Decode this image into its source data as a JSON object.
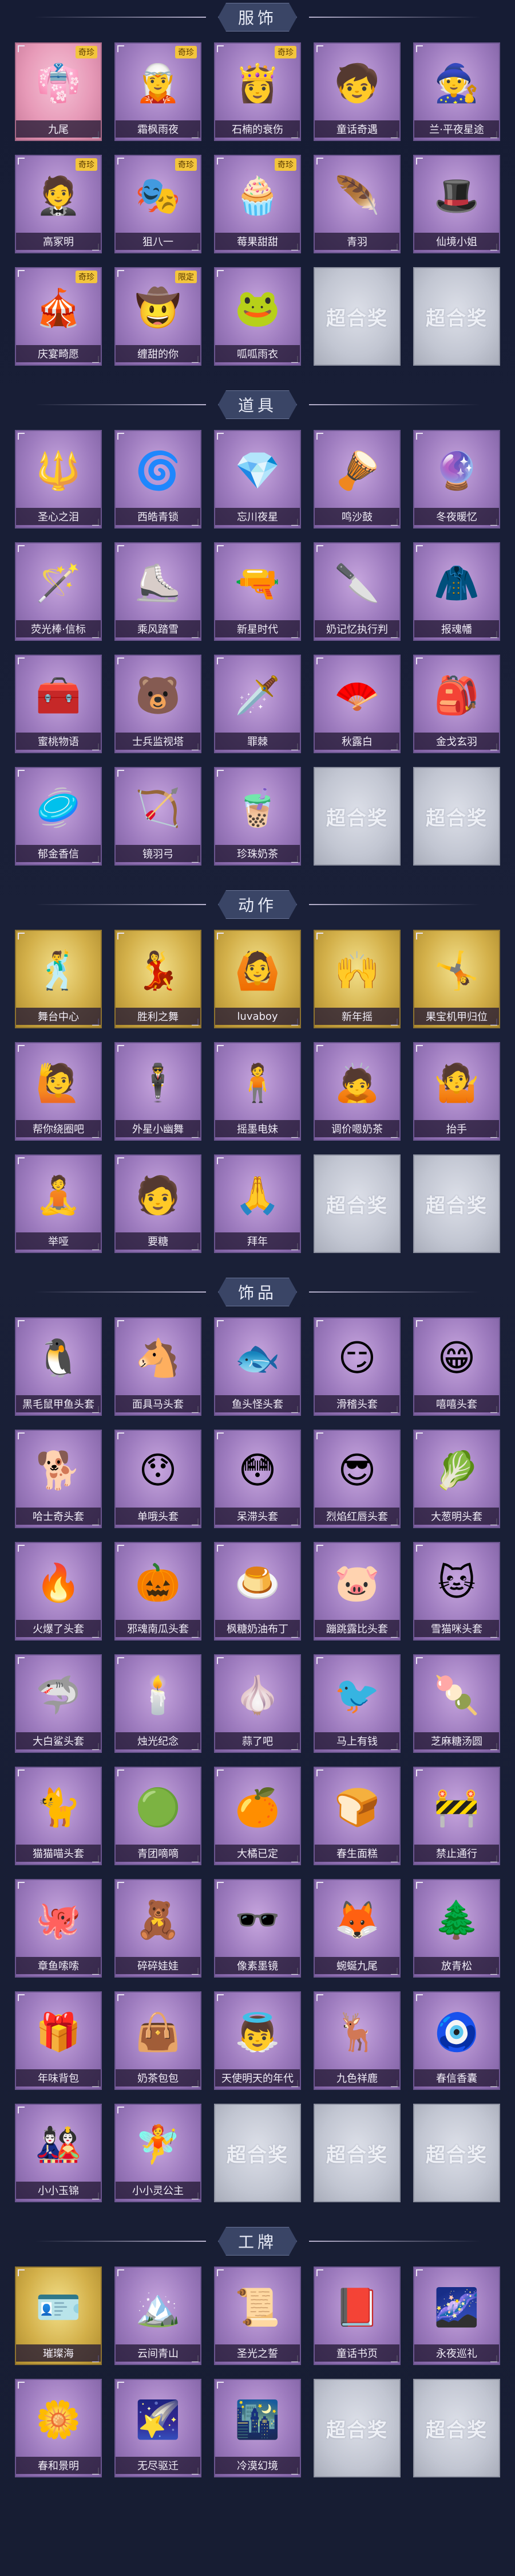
{
  "placeholder_text": "超合奖",
  "sections": [
    {
      "id": "outfits",
      "title": "服饰",
      "items": [
        {
          "name": "九尾",
          "icon": "👘",
          "style": "pink",
          "badge": "奇珍"
        },
        {
          "name": "霜枫雨夜",
          "icon": "🧝",
          "style": "purple",
          "badge": "奇珍"
        },
        {
          "name": "石楠的衰伤",
          "icon": "👸",
          "style": "purple",
          "badge": "奇珍"
        },
        {
          "name": "童话奇遇",
          "icon": "🧒",
          "style": "purple",
          "badge": ""
        },
        {
          "name": "兰·平夜星途",
          "icon": "🧙",
          "style": "purple",
          "badge": ""
        },
        {
          "name": "高冢明",
          "icon": "🤵",
          "style": "purple",
          "badge": "奇珍"
        },
        {
          "name": "狙八一",
          "icon": "🎭",
          "style": "purple",
          "badge": "奇珍"
        },
        {
          "name": "莓果甜甜",
          "icon": "🧁",
          "style": "purple",
          "badge": "奇珍"
        },
        {
          "name": "青羽",
          "icon": "🪶",
          "style": "purple",
          "badge": ""
        },
        {
          "name": "仙境小姐",
          "icon": "🎩",
          "style": "purple",
          "badge": ""
        },
        {
          "name": "庆宴畸愿",
          "icon": "🎪",
          "style": "purple",
          "badge": "奇珍"
        },
        {
          "name": "缠甜的你",
          "icon": "🤠",
          "style": "purple",
          "badge": "限定"
        },
        {
          "name": "呱呱雨衣",
          "icon": "🐸",
          "style": "purple",
          "badge": ""
        },
        {
          "name": "",
          "icon": "",
          "style": "empty",
          "badge": ""
        },
        {
          "name": "",
          "icon": "",
          "style": "empty",
          "badge": ""
        }
      ]
    },
    {
      "id": "props",
      "title": "道具",
      "items": [
        {
          "name": "圣心之泪",
          "icon": "🔱",
          "style": "purple",
          "badge": ""
        },
        {
          "name": "西皓青锁",
          "icon": "🌀",
          "style": "purple",
          "badge": ""
        },
        {
          "name": "忘川夜星",
          "icon": "💎",
          "style": "purple",
          "badge": ""
        },
        {
          "name": "鸣沙鼓",
          "icon": "🪘",
          "style": "purple",
          "badge": ""
        },
        {
          "name": "冬夜暖忆",
          "icon": "🔮",
          "style": "purple",
          "badge": ""
        },
        {
          "name": "荧光棒·信标",
          "icon": "🪄",
          "style": "purple",
          "badge": ""
        },
        {
          "name": "乘风踏雪",
          "icon": "⛸️",
          "style": "purple",
          "badge": ""
        },
        {
          "name": "新星时代",
          "icon": "🔫",
          "style": "purple",
          "badge": ""
        },
        {
          "name": "奶记忆执行判",
          "icon": "🔪",
          "style": "purple",
          "badge": ""
        },
        {
          "name": "报魂幡",
          "icon": "🧥",
          "style": "purple",
          "badge": ""
        },
        {
          "name": "蜜桃物语",
          "icon": "🧰",
          "style": "purple",
          "badge": ""
        },
        {
          "name": "士兵监视塔",
          "icon": "🐻",
          "style": "purple",
          "badge": ""
        },
        {
          "name": "罪棘",
          "icon": "🗡️",
          "style": "purple",
          "badge": ""
        },
        {
          "name": "秋露白",
          "icon": "🪭",
          "style": "purple",
          "badge": ""
        },
        {
          "name": "金戈玄羽",
          "icon": "🎒",
          "style": "purple",
          "badge": ""
        },
        {
          "name": "郁金香信",
          "icon": "🥏",
          "style": "purple",
          "badge": ""
        },
        {
          "name": "镜羽弓",
          "icon": "🏹",
          "style": "purple",
          "badge": ""
        },
        {
          "name": "珍珠奶茶",
          "icon": "🧋",
          "style": "purple",
          "badge": ""
        },
        {
          "name": "",
          "icon": "",
          "style": "empty",
          "badge": ""
        },
        {
          "name": "",
          "icon": "",
          "style": "empty",
          "badge": ""
        }
      ]
    },
    {
      "id": "actions",
      "title": "动作",
      "items": [
        {
          "name": "舞台中心",
          "icon": "🕺",
          "style": "gold",
          "badge": ""
        },
        {
          "name": "胜利之舞",
          "icon": "💃",
          "style": "gold",
          "badge": ""
        },
        {
          "name": "luvaboy",
          "icon": "🙆",
          "style": "gold",
          "badge": ""
        },
        {
          "name": "新年摇",
          "icon": "🙌",
          "style": "gold",
          "badge": ""
        },
        {
          "name": "果宝机甲归位",
          "icon": "🤸",
          "style": "gold",
          "badge": ""
        },
        {
          "name": "帮你绕圈吧",
          "icon": "🙋",
          "style": "purple",
          "badge": ""
        },
        {
          "name": "外星小幽舞",
          "icon": "🕴️",
          "style": "purple",
          "badge": ""
        },
        {
          "name": "摇墨电妹",
          "icon": "🧍",
          "style": "purple",
          "badge": ""
        },
        {
          "name": "调价嗯奶茶",
          "icon": "🙇",
          "style": "purple",
          "badge": ""
        },
        {
          "name": "抬手",
          "icon": "🤷",
          "style": "purple",
          "badge": ""
        },
        {
          "name": "举哑",
          "icon": "🧘",
          "style": "purple",
          "badge": ""
        },
        {
          "name": "要糖",
          "icon": "🧑",
          "style": "purple",
          "badge": ""
        },
        {
          "name": "拜年",
          "icon": "🙏",
          "style": "purple",
          "badge": ""
        },
        {
          "name": "",
          "icon": "",
          "style": "empty",
          "badge": ""
        },
        {
          "name": "",
          "icon": "",
          "style": "empty",
          "badge": ""
        }
      ]
    },
    {
      "id": "accessories",
      "title": "饰品",
      "items": [
        {
          "name": "黑毛鼠甲鱼头套",
          "icon": "🐧",
          "style": "purple",
          "badge": ""
        },
        {
          "name": "面具马头套",
          "icon": "🐴",
          "style": "purple",
          "badge": ""
        },
        {
          "name": "鱼头怪头套",
          "icon": "🐟",
          "style": "purple",
          "badge": ""
        },
        {
          "name": "滑稽头套",
          "icon": "😏",
          "style": "purple",
          "badge": ""
        },
        {
          "name": "嘻嘻头套",
          "icon": "😁",
          "style": "purple",
          "badge": ""
        },
        {
          "name": "哈士奇头套",
          "icon": "🐕",
          "style": "purple",
          "badge": ""
        },
        {
          "name": "单哦头套",
          "icon": "😯",
          "style": "purple",
          "badge": ""
        },
        {
          "name": "呆滞头套",
          "icon": "😳",
          "style": "purple",
          "badge": ""
        },
        {
          "name": "烈焰红唇头套",
          "icon": "😎",
          "style": "purple",
          "badge": ""
        },
        {
          "name": "大葱明头套",
          "icon": "🥬",
          "style": "purple",
          "badge": ""
        },
        {
          "name": "火爆了头套",
          "icon": "🔥",
          "style": "purple",
          "badge": ""
        },
        {
          "name": "邪魂南瓜头套",
          "icon": "🎃",
          "style": "purple",
          "badge": ""
        },
        {
          "name": "枫糖奶油布丁",
          "icon": "🍮",
          "style": "purple",
          "badge": ""
        },
        {
          "name": "蹦跳露比头套",
          "icon": "🐷",
          "style": "purple",
          "badge": ""
        },
        {
          "name": "雪猫咪头套",
          "icon": "🐱",
          "style": "purple",
          "badge": ""
        },
        {
          "name": "大白鲨头套",
          "icon": "🦈",
          "style": "purple",
          "badge": ""
        },
        {
          "name": "烛光纪念",
          "icon": "🕯️",
          "style": "purple",
          "badge": ""
        },
        {
          "name": "蒜了吧",
          "icon": "🧄",
          "style": "purple",
          "badge": ""
        },
        {
          "name": "马上有钱",
          "icon": "🐦",
          "style": "purple",
          "badge": ""
        },
        {
          "name": "芝麻糖汤圆",
          "icon": "🍡",
          "style": "purple",
          "badge": ""
        },
        {
          "name": "猫猫喵头套",
          "icon": "🐈",
          "style": "purple",
          "badge": ""
        },
        {
          "name": "青团嘀嘀",
          "icon": "🟢",
          "style": "purple",
          "badge": ""
        },
        {
          "name": "大橘已定",
          "icon": "🍊",
          "style": "purple",
          "badge": ""
        },
        {
          "name": "春生面糕",
          "icon": "🍞",
          "style": "purple",
          "badge": ""
        },
        {
          "name": "禁止通行",
          "icon": "🚧",
          "style": "purple",
          "badge": ""
        },
        {
          "name": "章鱼嗦嗦",
          "icon": "🐙",
          "style": "purple",
          "badge": ""
        },
        {
          "name": "碎碎娃娃",
          "icon": "🧸",
          "style": "purple",
          "badge": ""
        },
        {
          "name": "像素墨镜",
          "icon": "🕶️",
          "style": "purple",
          "badge": ""
        },
        {
          "name": "蜿蜒九尾",
          "icon": "🦊",
          "style": "purple",
          "badge": ""
        },
        {
          "name": "放青松",
          "icon": "🌲",
          "style": "purple",
          "badge": ""
        },
        {
          "name": "年味背包",
          "icon": "🎁",
          "style": "purple",
          "badge": ""
        },
        {
          "name": "奶茶包包",
          "icon": "👜",
          "style": "purple",
          "badge": ""
        },
        {
          "name": "天使明天的年代",
          "icon": "👼",
          "style": "purple",
          "badge": ""
        },
        {
          "name": "九色祥鹿",
          "icon": "🦌",
          "style": "purple",
          "badge": ""
        },
        {
          "name": "春信香囊",
          "icon": "🧿",
          "style": "purple",
          "badge": ""
        },
        {
          "name": "小小玉锦",
          "icon": "🎎",
          "style": "purple",
          "badge": ""
        },
        {
          "name": "小小灵公主",
          "icon": "🧚",
          "style": "purple",
          "badge": ""
        },
        {
          "name": "",
          "icon": "",
          "style": "empty",
          "badge": ""
        },
        {
          "name": "",
          "icon": "",
          "style": "empty",
          "badge": ""
        },
        {
          "name": "",
          "icon": "",
          "style": "empty",
          "badge": ""
        }
      ]
    },
    {
      "id": "badges",
      "title": "工牌",
      "items": [
        {
          "name": "璀璨海",
          "icon": "🪪",
          "style": "gold",
          "badge": ""
        },
        {
          "name": "云间青山",
          "icon": "🏔️",
          "style": "purple",
          "badge": ""
        },
        {
          "name": "圣光之誓",
          "icon": "📜",
          "style": "purple",
          "badge": ""
        },
        {
          "name": "童话书页",
          "icon": "📕",
          "style": "purple",
          "badge": ""
        },
        {
          "name": "永夜巡礼",
          "icon": "🌌",
          "style": "purple",
          "badge": ""
        },
        {
          "name": "春和景明",
          "icon": "🌼",
          "style": "purple",
          "badge": ""
        },
        {
          "name": "无尽驱迁",
          "icon": "🌠",
          "style": "purple",
          "badge": ""
        },
        {
          "name": "冷漠幻境",
          "icon": "🌃",
          "style": "purple",
          "badge": ""
        },
        {
          "name": "",
          "icon": "",
          "style": "empty",
          "badge": ""
        },
        {
          "name": "",
          "icon": "",
          "style": "empty",
          "badge": ""
        }
      ]
    }
  ]
}
